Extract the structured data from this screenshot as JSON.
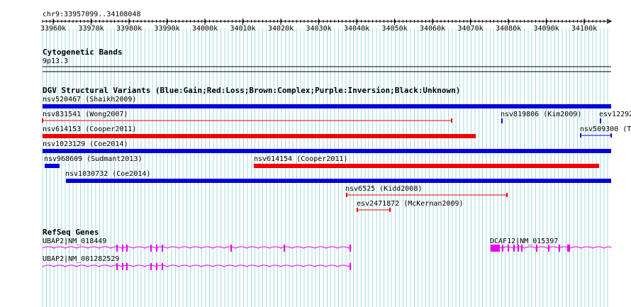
{
  "position": "chr9:33957099..34108048",
  "ruler": {
    "ticks": [
      "33960k",
      "33970k",
      "33980k",
      "33990k",
      "34000k",
      "34010k",
      "34020k",
      "34030k",
      "34040k",
      "34050k",
      "34060k",
      "34070k",
      "34080k",
      "34090k",
      "34100k"
    ]
  },
  "cytoband": {
    "title": "Cytogenetic Bands",
    "band": "9p13.3"
  },
  "dgv": {
    "title": "DGV Structural Variants (Blue:Gain;Red:Loss;Brown:Complex;Purple:Inversion;Black:Unknown)",
    "features": [
      {
        "label": "nsv520467 (Shaikh2009)",
        "type": "gain"
      },
      {
        "label": "nsv831541 (Wong2007)",
        "type": "loss"
      },
      {
        "label": "nsv819806 (Kim2009)",
        "type": "gain"
      },
      {
        "label": "esv12292",
        "type": "gain"
      },
      {
        "label": "nsv614153 (Cooper2011)",
        "type": "loss"
      },
      {
        "label": "nsv509300 (T",
        "type": "gain"
      },
      {
        "label": "nsv1023129 (Coe2014)",
        "type": "gain"
      },
      {
        "label": "nsv968609 (Sudmant2013)",
        "type": "gain"
      },
      {
        "label": "nsv614154 (Cooper2011)",
        "type": "loss"
      },
      {
        "label": "nsv1030732 (Coe2014)",
        "type": "gain"
      },
      {
        "label": "nsv6525 (Kidd2008)",
        "type": "loss"
      },
      {
        "label": "esv2471872 (McKernan2009)",
        "type": "loss"
      }
    ]
  },
  "refseq": {
    "title": "RefSeq Genes",
    "genes": [
      {
        "label": "UBAP2|NM_018449"
      },
      {
        "label": "UBAP2|NM_001282529"
      },
      {
        "label": "DCAF12|NM_015397"
      }
    ]
  },
  "colors": {
    "gain": "#0000dd",
    "loss": "#ee0000",
    "gene": "#ee00ee",
    "grid": "#a8d8e0"
  }
}
